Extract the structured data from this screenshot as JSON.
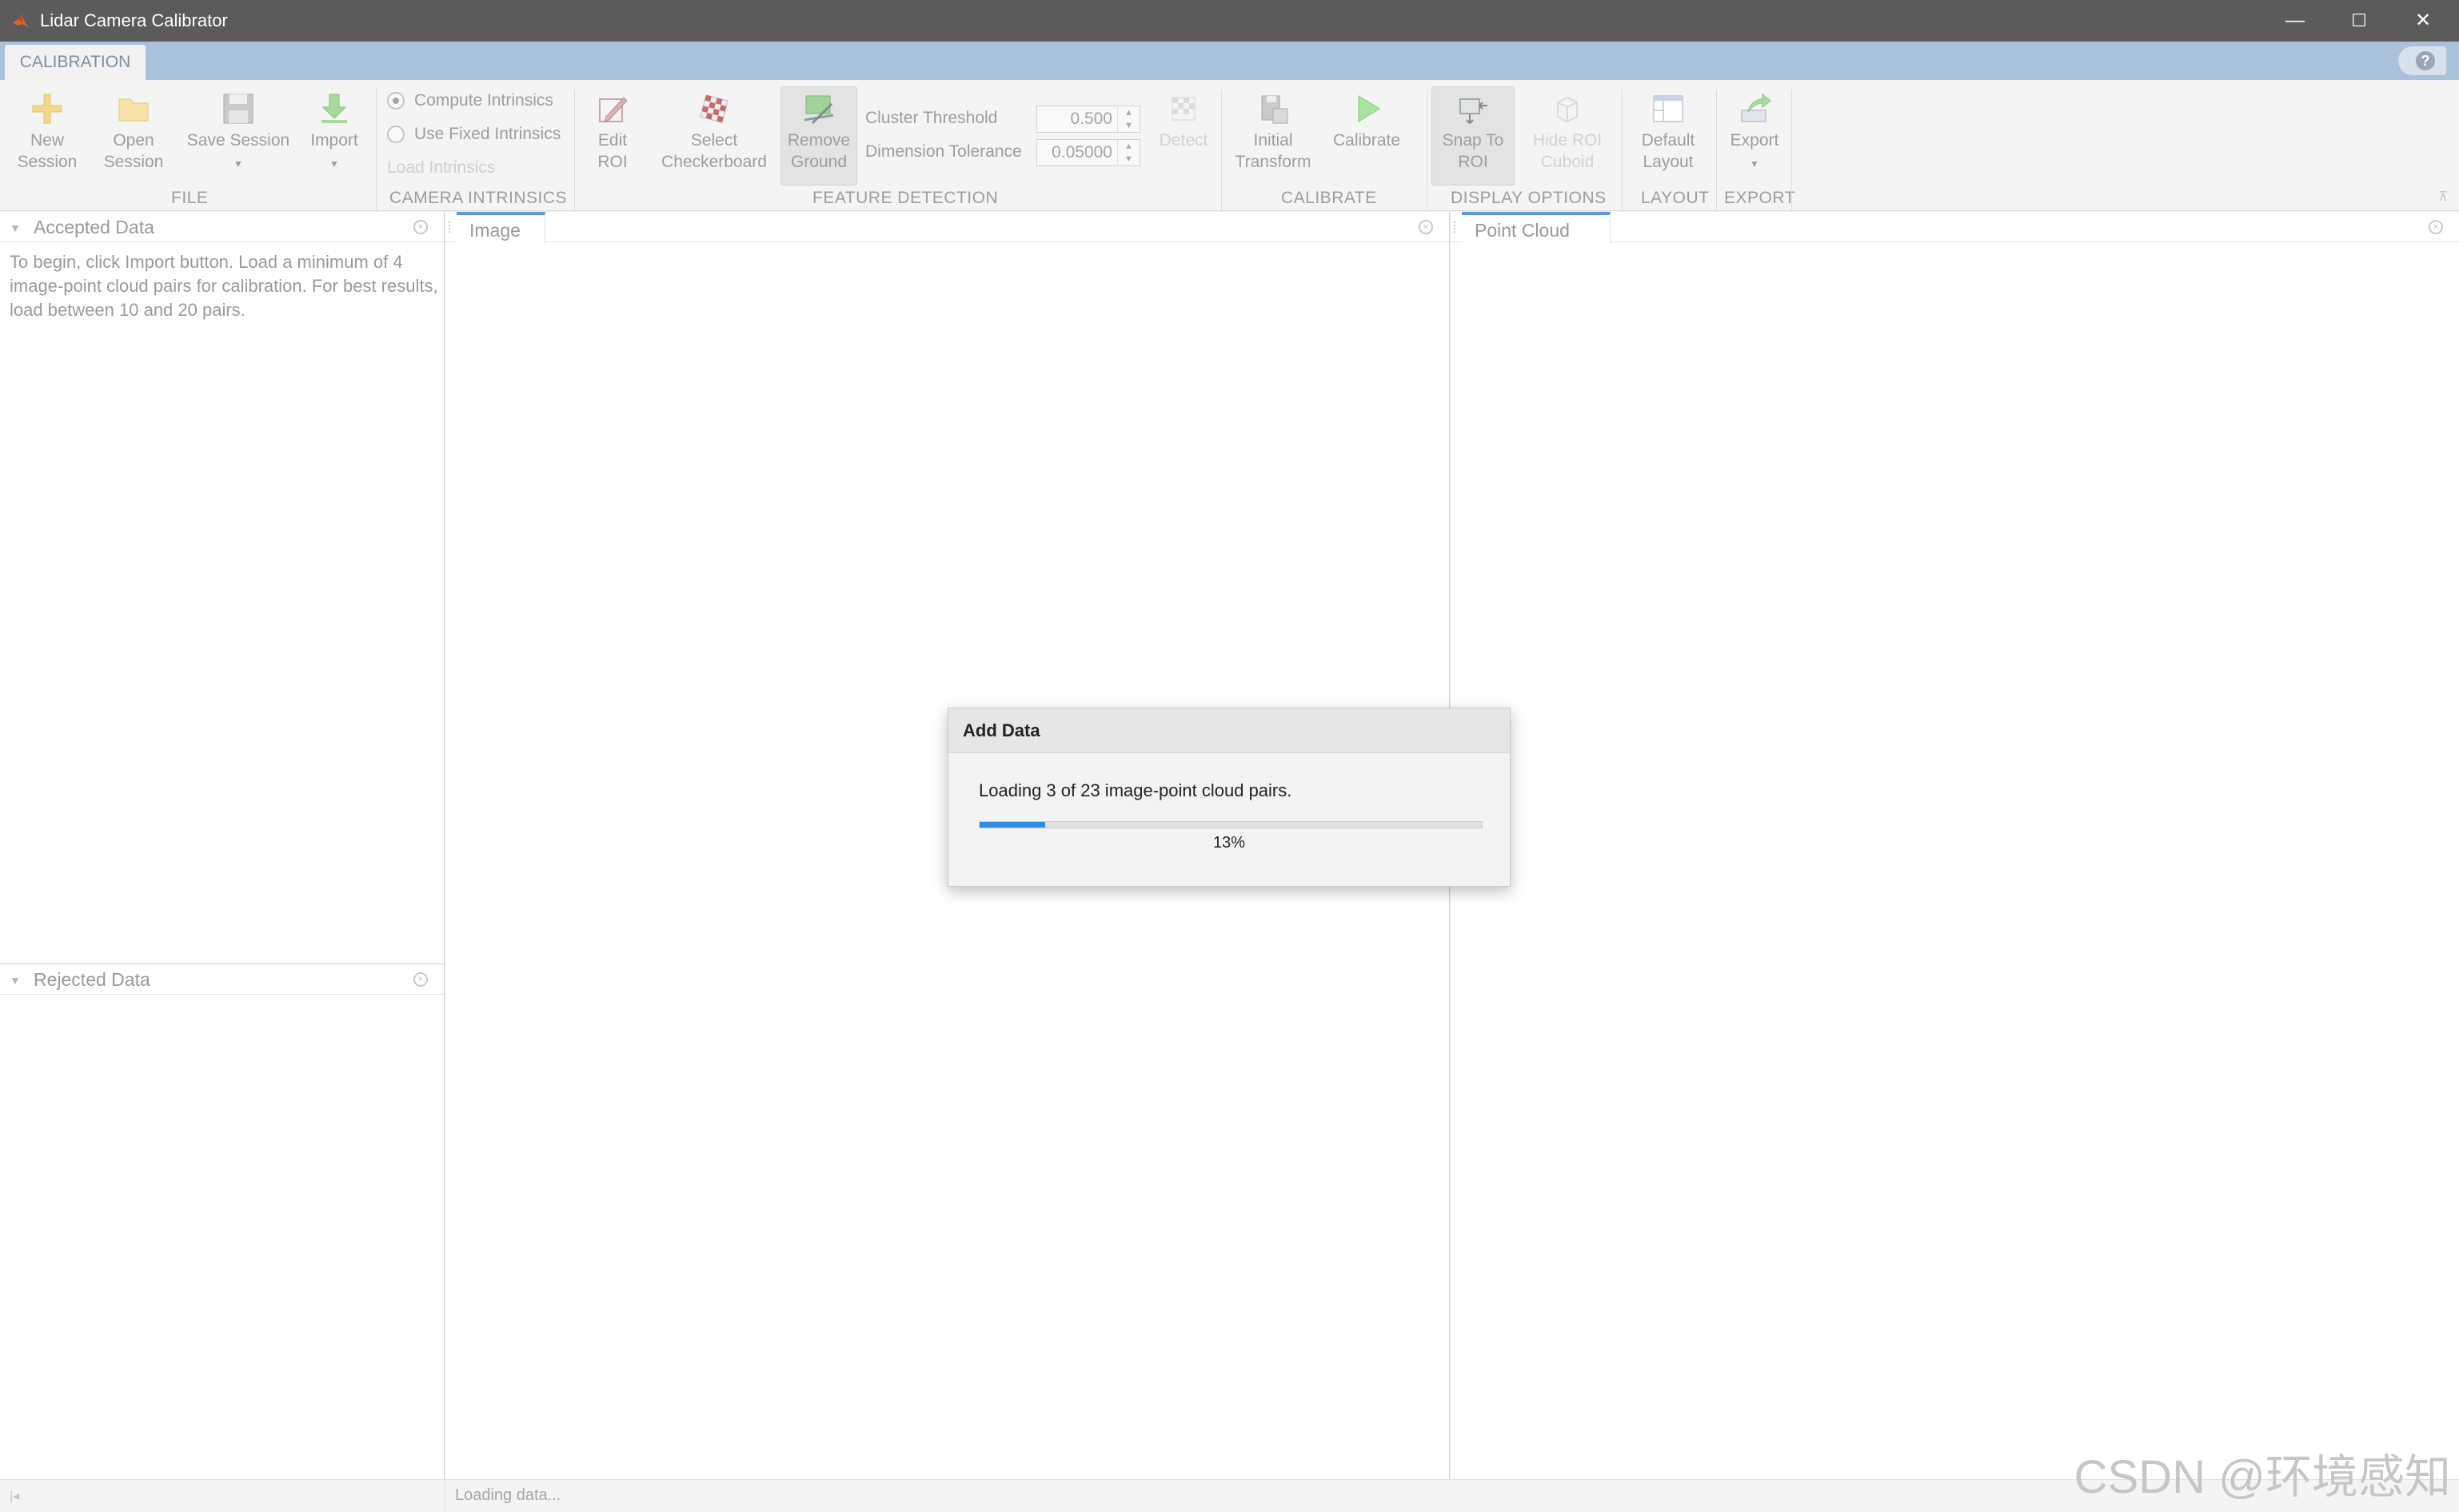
{
  "window": {
    "title": "Lidar Camera Calibrator",
    "controls": {
      "minimize": "—",
      "maximize": "☐",
      "close": "✕"
    }
  },
  "tab": {
    "label": "CALIBRATION"
  },
  "help_label": "?",
  "toolstrip": {
    "file": {
      "label": "FILE",
      "new_session": [
        "New",
        "Session"
      ],
      "open_session": [
        "Open",
        "Session"
      ],
      "save_session": "Save Session",
      "import": "Import"
    },
    "camera_intrinsics": {
      "label": "CAMERA INTRINSICS",
      "compute": "Compute Intrinsics",
      "use_fixed": "Use Fixed Intrinsics",
      "load": "Load Intrinsics",
      "selected": "compute"
    },
    "feature_detection": {
      "label": "FEATURE DETECTION",
      "edit_roi": [
        "Edit",
        "ROI"
      ],
      "select_checkerboard": [
        "Select",
        "Checkerboard"
      ],
      "remove_ground": [
        "Remove",
        "Ground"
      ],
      "cluster_threshold_label": "Cluster Threshold",
      "cluster_threshold_value": "0.500",
      "dimension_tolerance_label": "Dimension Tolerance",
      "dimension_tolerance_value": "0.05000",
      "detect": "Detect"
    },
    "calibrate": {
      "label": "CALIBRATE",
      "initial_transform": [
        "Initial",
        "Transform"
      ],
      "calibrate": "Calibrate"
    },
    "display_options": {
      "label": "DISPLAY OPTIONS",
      "snap_to_roi": [
        "Snap To",
        "ROI"
      ],
      "hide_roi_cuboid": [
        "Hide ROI",
        "Cuboid"
      ]
    },
    "layout": {
      "label": "LAYOUT",
      "default_layout": [
        "Default",
        "Layout"
      ]
    },
    "export": {
      "label": "EXPORT",
      "export": "Export"
    }
  },
  "panels": {
    "accepted": {
      "title": "Accepted Data",
      "hint": "To begin, click Import button. Load a minimum of 4 image-point cloud pairs for calibration. For best results, load between 10 and 20 pairs."
    },
    "rejected": {
      "title": "Rejected Data"
    },
    "image": {
      "title": "Image"
    },
    "point_cloud": {
      "title": "Point Cloud"
    }
  },
  "dialog": {
    "title": "Add Data",
    "message": "Loading 3 of 23 image-point cloud pairs.",
    "progress_percent": 13,
    "progress_label": "13%"
  },
  "statusbar": {
    "text": "Loading data..."
  },
  "watermark": "CSDN @环境感知",
  "colors": {
    "accent": "#2f8fe6",
    "titlebar": "#5b5b5b",
    "tabstrip": "#a9c2d9"
  }
}
